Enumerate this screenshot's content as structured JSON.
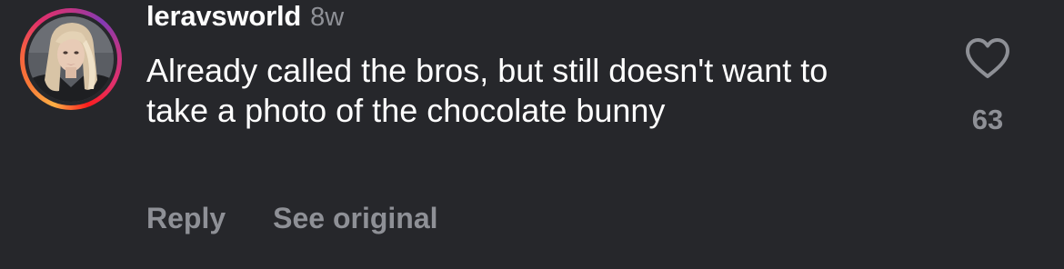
{
  "comment": {
    "username": "leravsworld",
    "timestamp": "8w",
    "text": "Already called the bros, but still doesn't want to take a photo of the chocolate bunny",
    "actions": {
      "reply_label": "Reply",
      "see_original_label": "See original"
    },
    "likes": {
      "count": "63",
      "icon": "heart-outline-icon"
    },
    "avatar": {
      "has_story_ring": true,
      "ring_colors": [
        "#fcaf45",
        "#f56040",
        "#e1306c",
        "#c13584",
        "#833ab4"
      ]
    }
  },
  "theme": {
    "background": "#26272b",
    "primary_text": "#ffffff",
    "secondary_text": "#8e9096"
  }
}
